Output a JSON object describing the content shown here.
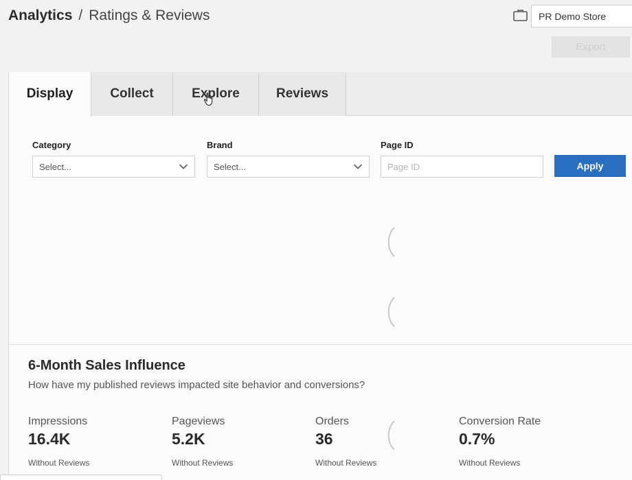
{
  "header": {
    "breadcrumb_root": "Analytics",
    "breadcrumb_sep": "/",
    "breadcrumb_page": "Ratings & Reviews",
    "store_name": "PR Demo Store",
    "export_label": "Export"
  },
  "tabs": [
    {
      "label": "Display",
      "active": true
    },
    {
      "label": "Collect",
      "active": false
    },
    {
      "label": "Explore",
      "active": false
    },
    {
      "label": "Reviews",
      "active": false
    }
  ],
  "filters": {
    "category_label": "Category",
    "category_value": "Select...",
    "brand_label": "Brand",
    "brand_value": "Select...",
    "pageid_label": "Page ID",
    "pageid_placeholder": "Page ID",
    "apply_label": "Apply"
  },
  "influence": {
    "title": "6-Month Sales Influence",
    "subtitle": "How have my published reviews impacted site behavior and conversions?",
    "metrics": [
      {
        "label": "Impressions",
        "value": "16.4K",
        "foot": "Without Reviews"
      },
      {
        "label": "Pageviews",
        "value": "5.2K",
        "foot": "Without Reviews"
      },
      {
        "label": "Orders",
        "value": "36",
        "foot": "Without Reviews"
      },
      {
        "label": "Conversion Rate",
        "value": "0.7%",
        "foot": "Without Reviews"
      }
    ]
  },
  "colors": {
    "accent": "#2a6ec0"
  },
  "icons": {
    "store": "briefcase-icon",
    "dropdown": "chevron-down-icon",
    "loading": "spinner-icon",
    "pointer": "hand-cursor-icon"
  }
}
